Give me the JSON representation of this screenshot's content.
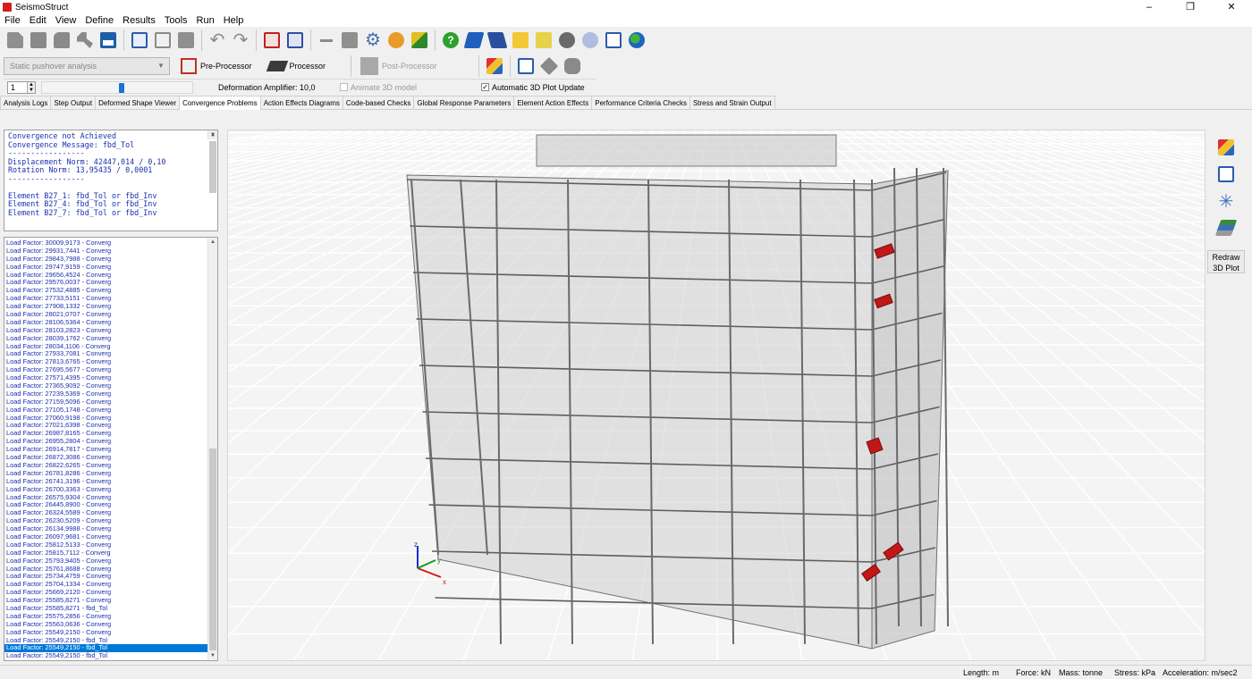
{
  "window": {
    "title": "SeismoStruct",
    "minimize": "–",
    "maximize": "❐",
    "close": "✕"
  },
  "menu": [
    "File",
    "Edit",
    "View",
    "Define",
    "Results",
    "Tools",
    "Run",
    "Help"
  ],
  "toolbar2": {
    "analysis_type": "Static pushover analysis",
    "preprocessor_label": "Pre-Processor",
    "processor_label": "Processor",
    "postprocessor_label": "Post-Processor"
  },
  "toolbar3": {
    "step_value": "1",
    "amplifier_label": "Deformation Amplifier: 10,0",
    "animate_label": "Animate 3D model",
    "animate_checked": false,
    "auto_update_label": "Automatic 3D Plot Update",
    "auto_update_checked": true
  },
  "tabs": [
    "Analysis Logs",
    "Step Output",
    "Deformed Shape Viewer",
    "Convergence Problems",
    "Action Effects Diagrams",
    "Code-based Checks",
    "Global Response Parameters",
    "Element Action Effects",
    "Performance Criteria Checks",
    "Stress and Strain Output"
  ],
  "active_tab": "Convergence Problems",
  "convergence_message": [
    "Convergence not Achieved",
    "Convergence Message: fbd_Tol",
    "-----------------",
    "Displacement Norm: 42447,014 / 0,10",
    "Rotation Norm: 13,95435 / 0,0001",
    "-----------------",
    "",
    "Element B27_1: fbd_Tol or fbd_Inv",
    "Element B27_4: fbd_Tol or fbd_Inv",
    "Element B27_7: fbd_Tol or fbd_Inv"
  ],
  "load_factor_log": [
    "Load Factor: 30009,9173 - Converg",
    "Load Factor: 29931,7441 - Converg",
    "Load Factor: 29843,7988 - Converg",
    "Load Factor: 29747,9159 - Converg",
    "Load Factor: 29656,4524 - Converg",
    "Load Factor: 29576,0037 - Converg",
    "Load Factor: 27532,4885 - Converg",
    "Load Factor: 27733,5151 - Converg",
    "Load Factor: 27908,1332 - Converg",
    "Load Factor: 28021,0707 - Converg",
    "Load Factor: 28106,5364 - Converg",
    "Load Factor: 28103,2823 - Converg",
    "Load Factor: 28039,1762 - Converg",
    "Load Factor: 28034,1106 - Converg",
    "Load Factor: 27933,7081 - Converg",
    "Load Factor: 27813,6765 - Converg",
    "Load Factor: 27695,5677 - Converg",
    "Load Factor: 27571,4395 - Converg",
    "Load Factor: 27365,9092 - Converg",
    "Load Factor: 27239,5369 - Converg",
    "Load Factor: 27159,5096 - Converg",
    "Load Factor: 27105,1748 - Converg",
    "Load Factor: 27060,9198 - Converg",
    "Load Factor: 27021,6398 - Converg",
    "Load Factor: 26987,8165 - Converg",
    "Load Factor: 26955,2804 - Converg",
    "Load Factor: 26914,7817 - Converg",
    "Load Factor: 26872,3086 - Converg",
    "Load Factor: 26822,6265 - Converg",
    "Load Factor: 26781,8286 - Converg",
    "Load Factor: 26741,3196 - Converg",
    "Load Factor: 26700,3363 - Converg",
    "Load Factor: 26575,9304 - Converg",
    "Load Factor: 26445,8900 - Converg",
    "Load Factor: 26324,5589 - Converg",
    "Load Factor: 26230,5209 - Converg",
    "Load Factor: 26134,9988 - Converg",
    "Load Factor: 26097,9681 - Converg",
    "Load Factor: 25812,5133 - Converg",
    "Load Factor: 25815,7112 - Converg",
    "Load Factor: 25793,9405 - Converg",
    "Load Factor: 25761,8688 - Converg",
    "Load Factor: 25734,4759 - Converg",
    "Load Factor: 25704,1334 - Converg",
    "Load Factor: 25669,2120 - Converg",
    "Load Factor: 25585,8271 - Converg",
    "Load Factor: 25585,8271 - fbd_Tol",
    "Load Factor: 25575,2856 - Converg",
    "Load Factor: 25563,0636 - Converg",
    "Load Factor: 25549,2150 - Converg",
    "Load Factor: 25549,2150 - fbd_Tol",
    "Load Factor: 25549,2150 - fbd_Tol",
    "Load Factor: 25549,2150 - fbd_Tol"
  ],
  "selected_log_index": 51,
  "viewport": {
    "axis_x": "x",
    "axis_y": "y",
    "axis_z": "z"
  },
  "side_panel": {
    "redraw_line1": "Redraw",
    "redraw_line2": "3D Plot"
  },
  "status": {
    "length": "Length: m",
    "force": "Force: kN",
    "mass": "Mass: tonne",
    "stress": "Stress: kPa",
    "acceleration": "Acceleration: m/sec2"
  },
  "colors": {
    "accent": "#0078d7",
    "log_text": "#1a2fb0",
    "damaged_element": "#c01818"
  }
}
